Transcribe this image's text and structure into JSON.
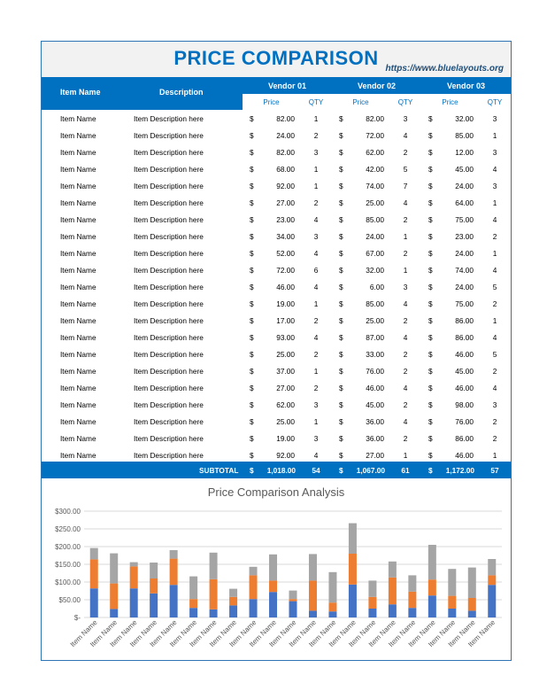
{
  "title": "PRICE COMPARISON",
  "url": "https://www.bluelayouts.org",
  "headers": {
    "item_name": "Item Name",
    "description": "Description",
    "vendors": [
      "Vendor 01",
      "Vendor 02",
      "Vendor 03"
    ],
    "price": "Price",
    "qty": "QTY"
  },
  "currency": "$",
  "rows": [
    {
      "name": "Item Name",
      "desc": "Item Description here",
      "v1p": "82.00",
      "v1q": "1",
      "v2p": "82.00",
      "v2q": "3",
      "v3p": "32.00",
      "v3q": "3"
    },
    {
      "name": "Item Name",
      "desc": "Item Description here",
      "v1p": "24.00",
      "v1q": "2",
      "v2p": "72.00",
      "v2q": "4",
      "v3p": "85.00",
      "v3q": "1"
    },
    {
      "name": "Item Name",
      "desc": "Item Description here",
      "v1p": "82.00",
      "v1q": "3",
      "v2p": "62.00",
      "v2q": "2",
      "v3p": "12.00",
      "v3q": "3"
    },
    {
      "name": "Item Name",
      "desc": "Item Description here",
      "v1p": "68.00",
      "v1q": "1",
      "v2p": "42.00",
      "v2q": "5",
      "v3p": "45.00",
      "v3q": "4"
    },
    {
      "name": "Item Name",
      "desc": "Item Description here",
      "v1p": "92.00",
      "v1q": "1",
      "v2p": "74.00",
      "v2q": "7",
      "v3p": "24.00",
      "v3q": "3"
    },
    {
      "name": "Item Name",
      "desc": "Item Description here",
      "v1p": "27.00",
      "v1q": "2",
      "v2p": "25.00",
      "v2q": "4",
      "v3p": "64.00",
      "v3q": "1"
    },
    {
      "name": "Item Name",
      "desc": "Item Description here",
      "v1p": "23.00",
      "v1q": "4",
      "v2p": "85.00",
      "v2q": "2",
      "v3p": "75.00",
      "v3q": "4"
    },
    {
      "name": "Item Name",
      "desc": "Item Description here",
      "v1p": "34.00",
      "v1q": "3",
      "v2p": "24.00",
      "v2q": "1",
      "v3p": "23.00",
      "v3q": "2"
    },
    {
      "name": "Item Name",
      "desc": "Item Description here",
      "v1p": "52.00",
      "v1q": "4",
      "v2p": "67.00",
      "v2q": "2",
      "v3p": "24.00",
      "v3q": "1"
    },
    {
      "name": "Item Name",
      "desc": "Item Description here",
      "v1p": "72.00",
      "v1q": "6",
      "v2p": "32.00",
      "v2q": "1",
      "v3p": "74.00",
      "v3q": "4"
    },
    {
      "name": "Item Name",
      "desc": "Item Description here",
      "v1p": "46.00",
      "v1q": "4",
      "v2p": "6.00",
      "v2q": "3",
      "v3p": "24.00",
      "v3q": "5"
    },
    {
      "name": "Item Name",
      "desc": "Item Description here",
      "v1p": "19.00",
      "v1q": "1",
      "v2p": "85.00",
      "v2q": "4",
      "v3p": "75.00",
      "v3q": "2"
    },
    {
      "name": "Item Name",
      "desc": "Item Description here",
      "v1p": "17.00",
      "v1q": "2",
      "v2p": "25.00",
      "v2q": "2",
      "v3p": "86.00",
      "v3q": "1"
    },
    {
      "name": "Item Name",
      "desc": "Item Description here",
      "v1p": "93.00",
      "v1q": "4",
      "v2p": "87.00",
      "v2q": "4",
      "v3p": "86.00",
      "v3q": "4"
    },
    {
      "name": "Item Name",
      "desc": "Item Description here",
      "v1p": "25.00",
      "v1q": "2",
      "v2p": "33.00",
      "v2q": "2",
      "v3p": "46.00",
      "v3q": "5"
    },
    {
      "name": "Item Name",
      "desc": "Item Description here",
      "v1p": "37.00",
      "v1q": "1",
      "v2p": "76.00",
      "v2q": "2",
      "v3p": "45.00",
      "v3q": "2"
    },
    {
      "name": "Item Name",
      "desc": "Item Description here",
      "v1p": "27.00",
      "v1q": "2",
      "v2p": "46.00",
      "v2q": "4",
      "v3p": "46.00",
      "v3q": "4"
    },
    {
      "name": "Item Name",
      "desc": "Item Description here",
      "v1p": "62.00",
      "v1q": "3",
      "v2p": "45.00",
      "v2q": "2",
      "v3p": "98.00",
      "v3q": "3"
    },
    {
      "name": "Item Name",
      "desc": "Item Description here",
      "v1p": "25.00",
      "v1q": "1",
      "v2p": "36.00",
      "v2q": "4",
      "v3p": "76.00",
      "v3q": "2"
    },
    {
      "name": "Item Name",
      "desc": "Item Description here",
      "v1p": "19.00",
      "v1q": "3",
      "v2p": "36.00",
      "v2q": "2",
      "v3p": "86.00",
      "v3q": "2"
    },
    {
      "name": "Item Name",
      "desc": "Item Description here",
      "v1p": "92.00",
      "v1q": "4",
      "v2p": "27.00",
      "v2q": "1",
      "v3p": "46.00",
      "v3q": "1"
    }
  ],
  "subtotal": {
    "label": "SUBTOTAL",
    "v1_total": "1,018.00",
    "v1_qty": "54",
    "v2_total": "1,067.00",
    "v2_qty": "61",
    "v3_total": "1,172.00",
    "v3_qty": "57"
  },
  "colors": {
    "header_blue": "#0070c0",
    "series1": "#4472c4",
    "series2": "#ed7d31",
    "series3": "#a5a5a5"
  },
  "chart_data": {
    "type": "bar",
    "stacked": true,
    "title": "Price Comparison Analysis",
    "categories": [
      "Item Name",
      "Item Name",
      "Item Name",
      "Item Name",
      "Item Name",
      "Item Name",
      "Item Name",
      "Item Name",
      "Item Name",
      "Item Name",
      "Item Name",
      "Item Name",
      "Item Name",
      "Item Name",
      "Item Name",
      "Item Name",
      "Item Name",
      "Item Name",
      "Item Name",
      "Item Name",
      "Item Name"
    ],
    "series": [
      {
        "values": [
          82,
          24,
          82,
          68,
          92,
          27,
          23,
          34,
          52,
          72,
          46,
          19,
          17,
          93,
          25,
          37,
          27,
          62,
          25,
          19,
          92
        ],
        "color": "#4472c4"
      },
      {
        "values": [
          82,
          72,
          62,
          42,
          74,
          25,
          85,
          24,
          67,
          32,
          6,
          85,
          25,
          87,
          33,
          76,
          46,
          45,
          36,
          36,
          27
        ],
        "color": "#ed7d31"
      },
      {
        "values": [
          32,
          85,
          12,
          45,
          24,
          64,
          75,
          23,
          24,
          74,
          24,
          75,
          86,
          86,
          46,
          45,
          46,
          98,
          76,
          86,
          46
        ],
        "color": "#a5a5a5"
      }
    ],
    "ylim": [
      0,
      300
    ],
    "yticks": [
      "$-",
      "$50.00",
      "$100.00",
      "$150.00",
      "$200.00",
      "$250.00",
      "$300.00"
    ],
    "grid": true
  }
}
